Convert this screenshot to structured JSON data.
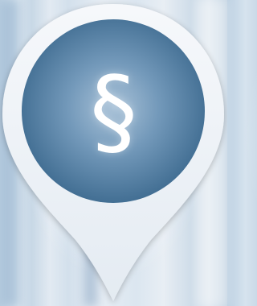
{
  "marker": {
    "symbol": "§",
    "icon": "paragraph-section-icon",
    "colors": {
      "pin_fill": "#eef2f7",
      "disc_center": "#9ab7d1",
      "disc_edge": "#3d6a8f",
      "symbol": "#ffffff"
    }
  }
}
